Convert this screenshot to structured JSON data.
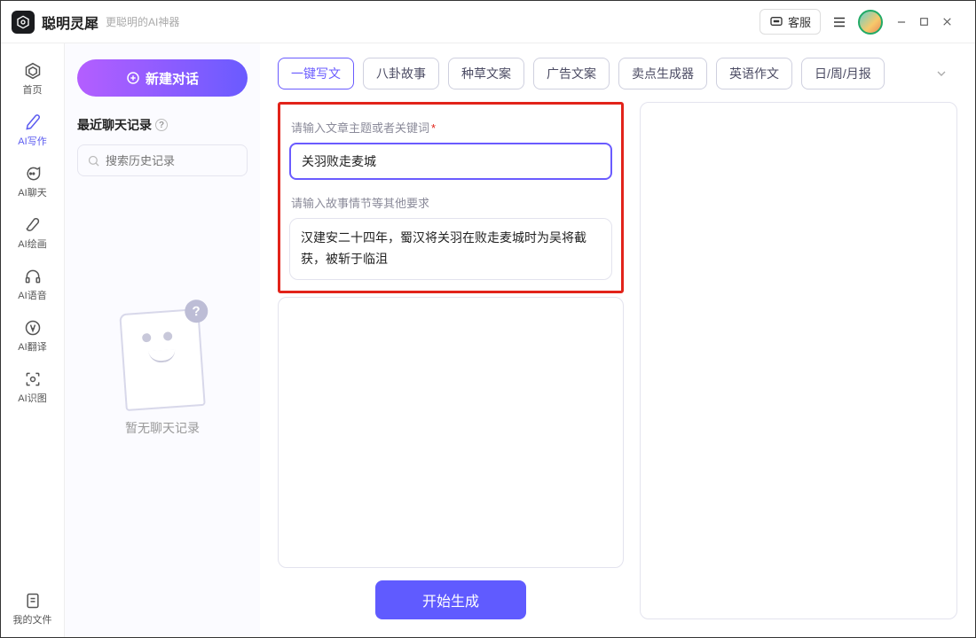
{
  "app": {
    "title": "聪明灵犀",
    "subtitle": "更聪明的AI神器"
  },
  "titlebar": {
    "support_label": "客服"
  },
  "nav": {
    "home": "首页",
    "write": "AI写作",
    "chat": "AI聊天",
    "paint": "AI绘画",
    "voice": "AI语音",
    "translate": "AI翻译",
    "ocr": "AI识图",
    "myfiles": "我的文件"
  },
  "history": {
    "new_chat": "新建对话",
    "recent_title": "最近聊天记录",
    "search_placeholder": "搜索历史记录",
    "empty_text": "暂无聊天记录"
  },
  "tabs": {
    "items": [
      "一键写文",
      "八卦故事",
      "种草文案",
      "广告文案",
      "卖点生成器",
      "英语作文",
      "日/周/月报"
    ],
    "active_index": 0
  },
  "form": {
    "topic_label": "请输入文章主题或者关键词",
    "topic_value": "关羽败走麦城",
    "details_label": "请输入故事情节等其他要求",
    "details_value": "汉建安二十四年，蜀汉将关羽在败走麦城时为吴将截获，被斩于临沮",
    "generate_label": "开始生成"
  }
}
